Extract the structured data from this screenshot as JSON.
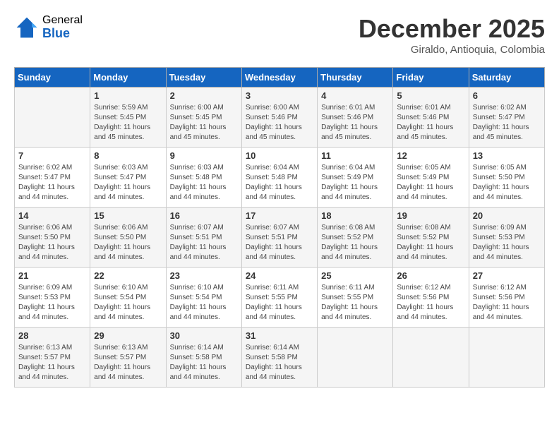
{
  "logo": {
    "general": "General",
    "blue": "Blue"
  },
  "title": "December 2025",
  "location": "Giraldo, Antioquia, Colombia",
  "days_of_week": [
    "Sunday",
    "Monday",
    "Tuesday",
    "Wednesday",
    "Thursday",
    "Friday",
    "Saturday"
  ],
  "weeks": [
    [
      {
        "day": "",
        "info": ""
      },
      {
        "day": "1",
        "info": "Sunrise: 5:59 AM\nSunset: 5:45 PM\nDaylight: 11 hours\nand 45 minutes."
      },
      {
        "day": "2",
        "info": "Sunrise: 6:00 AM\nSunset: 5:45 PM\nDaylight: 11 hours\nand 45 minutes."
      },
      {
        "day": "3",
        "info": "Sunrise: 6:00 AM\nSunset: 5:46 PM\nDaylight: 11 hours\nand 45 minutes."
      },
      {
        "day": "4",
        "info": "Sunrise: 6:01 AM\nSunset: 5:46 PM\nDaylight: 11 hours\nand 45 minutes."
      },
      {
        "day": "5",
        "info": "Sunrise: 6:01 AM\nSunset: 5:46 PM\nDaylight: 11 hours\nand 45 minutes."
      },
      {
        "day": "6",
        "info": "Sunrise: 6:02 AM\nSunset: 5:47 PM\nDaylight: 11 hours\nand 45 minutes."
      }
    ],
    [
      {
        "day": "7",
        "info": "Sunrise: 6:02 AM\nSunset: 5:47 PM\nDaylight: 11 hours\nand 44 minutes."
      },
      {
        "day": "8",
        "info": "Sunrise: 6:03 AM\nSunset: 5:47 PM\nDaylight: 11 hours\nand 44 minutes."
      },
      {
        "day": "9",
        "info": "Sunrise: 6:03 AM\nSunset: 5:48 PM\nDaylight: 11 hours\nand 44 minutes."
      },
      {
        "day": "10",
        "info": "Sunrise: 6:04 AM\nSunset: 5:48 PM\nDaylight: 11 hours\nand 44 minutes."
      },
      {
        "day": "11",
        "info": "Sunrise: 6:04 AM\nSunset: 5:49 PM\nDaylight: 11 hours\nand 44 minutes."
      },
      {
        "day": "12",
        "info": "Sunrise: 6:05 AM\nSunset: 5:49 PM\nDaylight: 11 hours\nand 44 minutes."
      },
      {
        "day": "13",
        "info": "Sunrise: 6:05 AM\nSunset: 5:50 PM\nDaylight: 11 hours\nand 44 minutes."
      }
    ],
    [
      {
        "day": "14",
        "info": "Sunrise: 6:06 AM\nSunset: 5:50 PM\nDaylight: 11 hours\nand 44 minutes."
      },
      {
        "day": "15",
        "info": "Sunrise: 6:06 AM\nSunset: 5:50 PM\nDaylight: 11 hours\nand 44 minutes."
      },
      {
        "day": "16",
        "info": "Sunrise: 6:07 AM\nSunset: 5:51 PM\nDaylight: 11 hours\nand 44 minutes."
      },
      {
        "day": "17",
        "info": "Sunrise: 6:07 AM\nSunset: 5:51 PM\nDaylight: 11 hours\nand 44 minutes."
      },
      {
        "day": "18",
        "info": "Sunrise: 6:08 AM\nSunset: 5:52 PM\nDaylight: 11 hours\nand 44 minutes."
      },
      {
        "day": "19",
        "info": "Sunrise: 6:08 AM\nSunset: 5:52 PM\nDaylight: 11 hours\nand 44 minutes."
      },
      {
        "day": "20",
        "info": "Sunrise: 6:09 AM\nSunset: 5:53 PM\nDaylight: 11 hours\nand 44 minutes."
      }
    ],
    [
      {
        "day": "21",
        "info": "Sunrise: 6:09 AM\nSunset: 5:53 PM\nDaylight: 11 hours\nand 44 minutes."
      },
      {
        "day": "22",
        "info": "Sunrise: 6:10 AM\nSunset: 5:54 PM\nDaylight: 11 hours\nand 44 minutes."
      },
      {
        "day": "23",
        "info": "Sunrise: 6:10 AM\nSunset: 5:54 PM\nDaylight: 11 hours\nand 44 minutes."
      },
      {
        "day": "24",
        "info": "Sunrise: 6:11 AM\nSunset: 5:55 PM\nDaylight: 11 hours\nand 44 minutes."
      },
      {
        "day": "25",
        "info": "Sunrise: 6:11 AM\nSunset: 5:55 PM\nDaylight: 11 hours\nand 44 minutes."
      },
      {
        "day": "26",
        "info": "Sunrise: 6:12 AM\nSunset: 5:56 PM\nDaylight: 11 hours\nand 44 minutes."
      },
      {
        "day": "27",
        "info": "Sunrise: 6:12 AM\nSunset: 5:56 PM\nDaylight: 11 hours\nand 44 minutes."
      }
    ],
    [
      {
        "day": "28",
        "info": "Sunrise: 6:13 AM\nSunset: 5:57 PM\nDaylight: 11 hours\nand 44 minutes."
      },
      {
        "day": "29",
        "info": "Sunrise: 6:13 AM\nSunset: 5:57 PM\nDaylight: 11 hours\nand 44 minutes."
      },
      {
        "day": "30",
        "info": "Sunrise: 6:14 AM\nSunset: 5:58 PM\nDaylight: 11 hours\nand 44 minutes."
      },
      {
        "day": "31",
        "info": "Sunrise: 6:14 AM\nSunset: 5:58 PM\nDaylight: 11 hours\nand 44 minutes."
      },
      {
        "day": "",
        "info": ""
      },
      {
        "day": "",
        "info": ""
      },
      {
        "day": "",
        "info": ""
      }
    ]
  ]
}
